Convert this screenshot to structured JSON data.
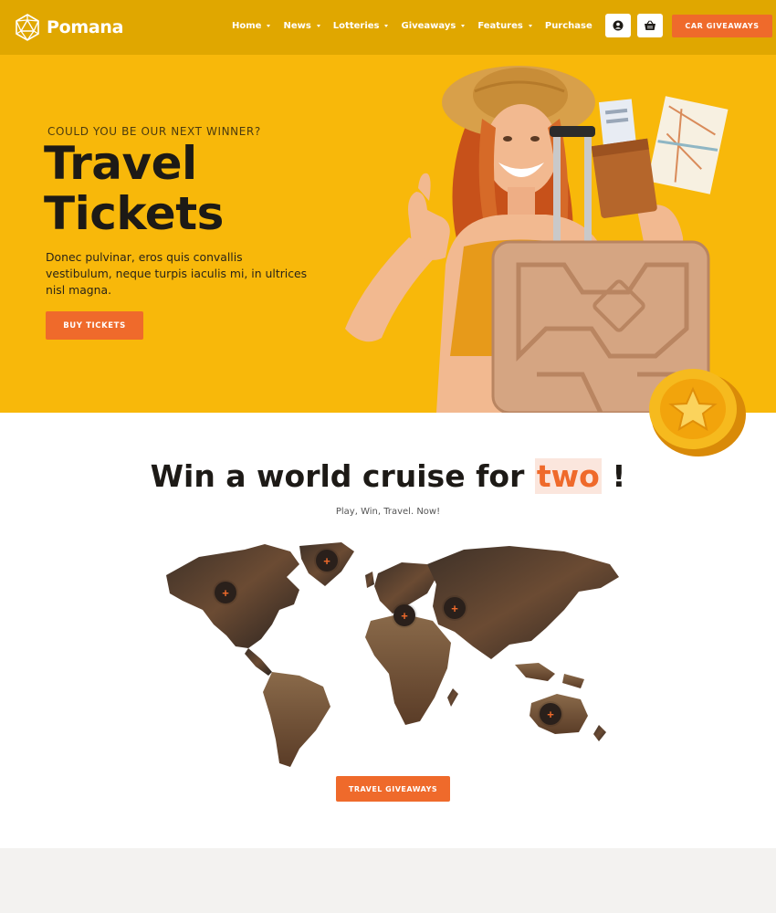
{
  "brand": {
    "name": "Pomana",
    "logo_icon": "polyhedron-icon"
  },
  "nav": {
    "items": [
      {
        "label": "Home",
        "has_dropdown": true
      },
      {
        "label": "News",
        "has_dropdown": true
      },
      {
        "label": "Lotteries",
        "has_dropdown": true
      },
      {
        "label": "Giveaways",
        "has_dropdown": true
      },
      {
        "label": "Features",
        "has_dropdown": true
      },
      {
        "label": "Purchase",
        "has_dropdown": false
      }
    ],
    "icons": [
      "user-icon",
      "basket-icon"
    ],
    "cta_label": "CAR GIVEAWAYS"
  },
  "hero": {
    "eyebrow": "COULD YOU BE OUR NEXT WINNER?",
    "title_line1": "Travel",
    "title_line2": "Tickets",
    "description": "Donec pulvinar, eros quis convallis vestibulum, neque turpis iaculis mi, in ultrices nisl magna.",
    "button_label": "BUY TICKETS"
  },
  "cruise": {
    "title_main": "Win a world cruise for",
    "title_highlight": "two",
    "title_end": "!",
    "subtitle": "Play, Win, Travel. Now!",
    "map_pin_symbol": "+",
    "button_label": "TRAVEL GIVEAWAYS"
  },
  "colors": {
    "brand_yellow": "#f8b80a",
    "header_yellow": "#e0a700",
    "accent_orange": "#ef6a2b",
    "dark_text": "#1d1a16"
  }
}
